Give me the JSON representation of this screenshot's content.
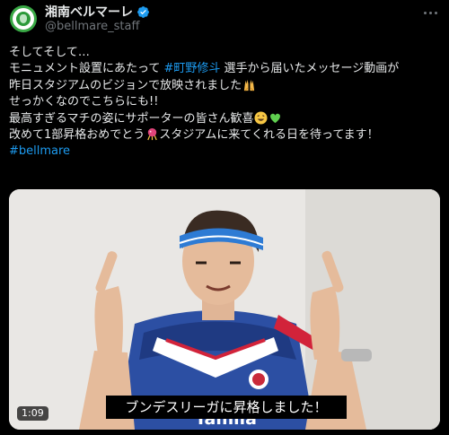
{
  "account": {
    "display_name": "湘南ベルマーレ",
    "handle": "@bellmare_staff",
    "verified_color": "#1d9bf0",
    "brand_color": "#39a845"
  },
  "tweet": {
    "lines": [
      {
        "text": "そしてそして…"
      },
      {
        "before": "モニュメント設置にあたって ",
        "link": "#町野修斗",
        "after": " 選手から届いたメッセージ動画が"
      },
      {
        "text": "昨日スタジアムのビジョンで放映されました",
        "emoji": "raised-hands"
      },
      {
        "text": "せっかくなのでこちらにも!!"
      },
      {
        "text": "最高すぎるマチの姿にサポーターの皆さん歓喜",
        "emoji": "grinning-face",
        "emoji2": "green-heart"
      },
      {
        "before": "改めて1部昇格おめでとう",
        "emoji_mid": "confetti-ball",
        "after": "スタジアムに来てくれる日を待ってます！"
      },
      {
        "link": "#bellmare"
      }
    ],
    "link_color": "#1d9bf0"
  },
  "video": {
    "duration": "1:09",
    "subtitle": "ブンデスリーガに昇格しました！",
    "jersey_text": "Tamila",
    "icons": [
      "more-icon",
      "verified-badge-icon"
    ]
  }
}
